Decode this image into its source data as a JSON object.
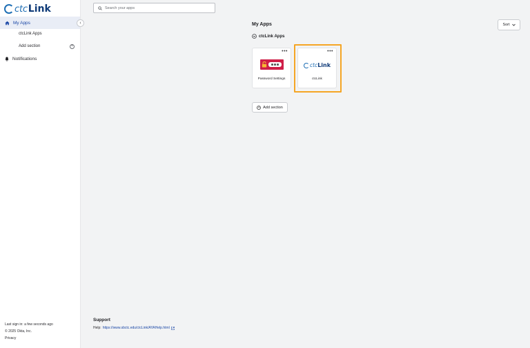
{
  "sidebar": {
    "logo": {
      "ctc": "ctc",
      "link": "Link"
    },
    "nav_my_apps": "My Apps",
    "nav_ctclink_apps": "ctcLink Apps",
    "nav_add_section": "Add section",
    "nav_notifications": "Notifications",
    "footer": {
      "last_sign_in": "Last sign in: a few seconds ago",
      "copyright": "© 2025 Okta, Inc.",
      "privacy": "Privacy"
    }
  },
  "search": {
    "placeholder": "Search your apps"
  },
  "main": {
    "title": "My Apps",
    "sort_label": "Sort",
    "section_title": "ctcLink Apps",
    "apps": [
      {
        "label": "Password Settings",
        "icon": "password-lock-logo"
      },
      {
        "label": "ctcLink",
        "icon": "ctclink-logo"
      }
    ],
    "add_section_label": "Add section"
  },
  "support": {
    "title": "Support",
    "help_prefix": "Help:",
    "help_link": "https://www.sbctc.edu/ctcLink/AYAHelp.html"
  },
  "colors": {
    "accent": "#1a47a6",
    "highlight": "#f5a524",
    "password_logo": "#cf1f48"
  }
}
